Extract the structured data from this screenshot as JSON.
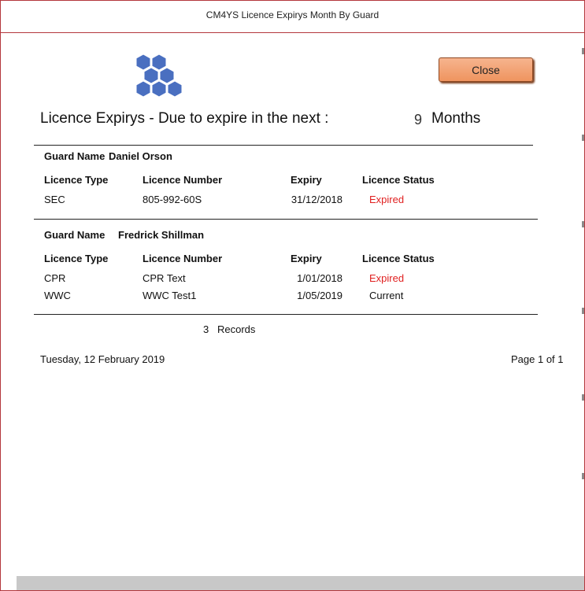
{
  "window": {
    "title": "CM4YS Licence Expirys Month By Guard"
  },
  "toolbar": {
    "close_label": "Close"
  },
  "report": {
    "heading": "Licence Expirys - Due to expire in the next :",
    "months_value": "9",
    "months_label": "Months",
    "guard_label": "Guard Name",
    "columns": [
      "Licence Type",
      "Licence Number",
      "Expiry",
      "Licence Status"
    ],
    "guards": [
      {
        "name": "Daniel Orson",
        "licences": [
          {
            "type": "SEC",
            "number": "805-992-60S",
            "expiry": "31/12/2018",
            "status": "Expired"
          }
        ]
      },
      {
        "name": "Fredrick Shillman",
        "licences": [
          {
            "type": "CPR",
            "number": "CPR Text",
            "expiry": "1/01/2018",
            "status": "Expired"
          },
          {
            "type": "WWC",
            "number": "WWC Test1",
            "expiry": "1/05/2019",
            "status": "Current"
          }
        ]
      }
    ],
    "records_count": "3",
    "records_label": "Records",
    "date": "Tuesday, 12 February 2019",
    "page": "Page 1 of 1"
  },
  "colors": {
    "expired": "#e02020",
    "frame": "#b4373d",
    "button": "#f0a070"
  },
  "icons": {
    "logo": "hexagon-cluster-logo-icon"
  }
}
